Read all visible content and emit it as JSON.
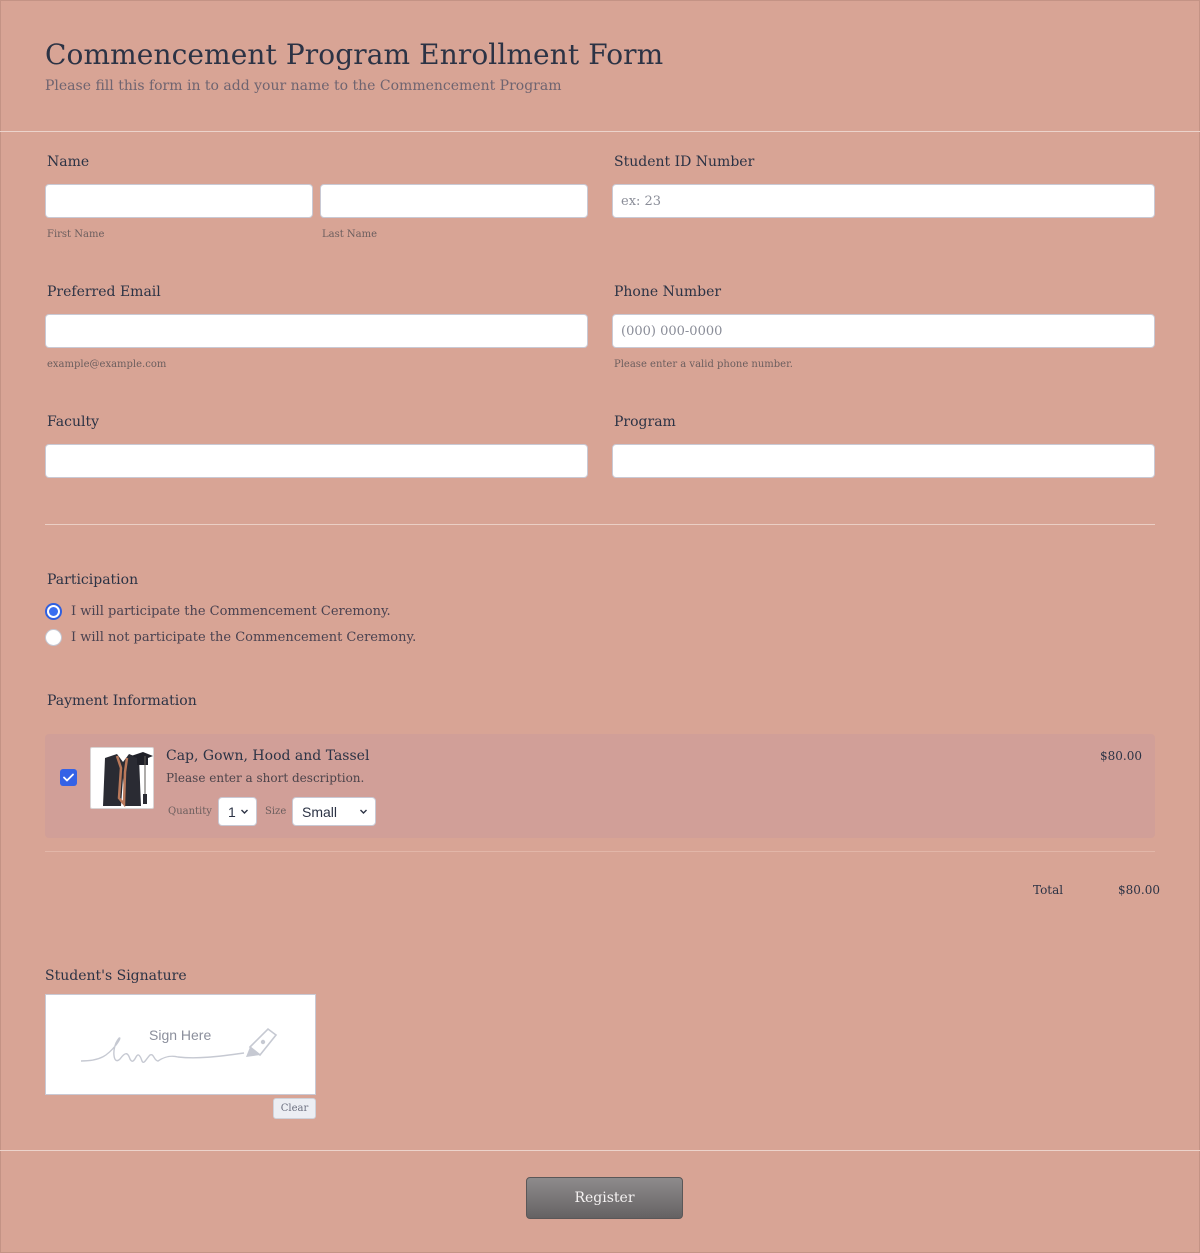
{
  "form": {
    "title": "Commencement Program Enrollment Form",
    "subtitle": "Please fill this form in to add your name to the Commencement Program"
  },
  "fields": {
    "name": {
      "label": "Name",
      "first_sublabel": "First Name",
      "last_sublabel": "Last Name",
      "first_value": "",
      "last_value": ""
    },
    "student_id": {
      "label": "Student ID Number",
      "placeholder": "ex: 23",
      "value": ""
    },
    "email": {
      "label": "Preferred Email",
      "sublabel": "example@example.com",
      "value": ""
    },
    "phone": {
      "label": "Phone Number",
      "placeholder": "(000) 000-0000",
      "sublabel": "Please enter a valid phone number.",
      "value": ""
    },
    "faculty": {
      "label": "Faculty",
      "value": ""
    },
    "program": {
      "label": "Program",
      "value": ""
    }
  },
  "participation": {
    "label": "Participation",
    "options": [
      {
        "label": "I will participate the Commencement Ceremony.",
        "selected": true
      },
      {
        "label": "I will not participate the Commencement Ceremony.",
        "selected": false
      }
    ]
  },
  "payment": {
    "label": "Payment Information",
    "product": {
      "name": "Cap, Gown, Hood and Tassel",
      "description": "Please enter a short description.",
      "price": "$80.00",
      "checked": true,
      "image_icon": "graduation-gown-icon",
      "quantity_label": "Quantity",
      "quantity_value": "1",
      "size_label": "Size",
      "size_value": "Small"
    },
    "total_label": "Total",
    "total_value": "$80.00"
  },
  "signature": {
    "label": "Student's Signature",
    "placeholder": "Sign Here",
    "clear_label": "Clear"
  },
  "submit": {
    "label": "Register"
  },
  "colors": {
    "background": "#d8a495",
    "product_bg": "#d19f98",
    "accent": "#3462e6",
    "submit_button": "#7a7778"
  }
}
